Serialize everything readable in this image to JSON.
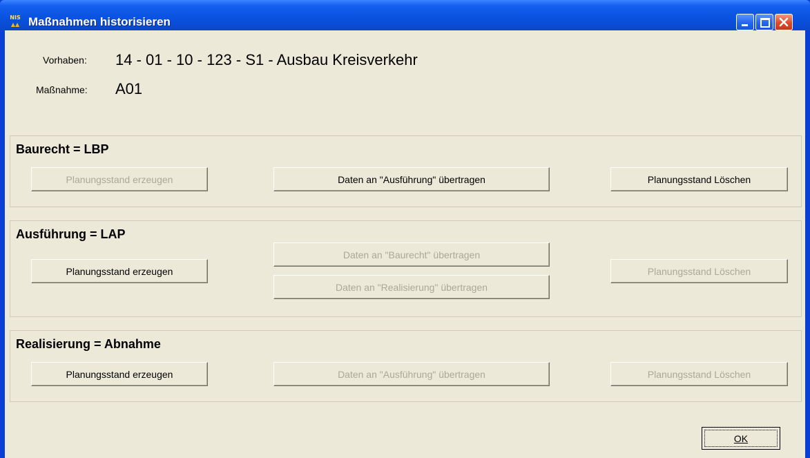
{
  "window": {
    "title": "Maßnahmen historisieren",
    "icon_line1": "NIS",
    "icon_line2": "▲▲"
  },
  "header": {
    "vorhaben_label": "Vorhaben:",
    "vorhaben_value": "14 - 01 - 10 - 123 - S1 - Ausbau Kreisverkehr",
    "massnahme_label": "Maßnahme:",
    "massnahme_value": "A01"
  },
  "groups": [
    {
      "title": "Baurecht = LBP",
      "create_label": "Planungsstand erzeugen",
      "transfer_label": "Daten an \"Ausführung\" übertragen",
      "delete_label": "Planungsstand Löschen"
    },
    {
      "title": "Ausführung = LAP",
      "create_label": "Planungsstand erzeugen",
      "transfer_baurecht_label": "Daten an \"Baurecht\" übertragen",
      "transfer_realisierung_label": "Daten an \"Realisierung\" übertragen",
      "delete_label": "Planungsstand Löschen"
    },
    {
      "title": "Realisierung = Abnahme",
      "create_label": "Planungsstand erzeugen",
      "transfer_label": "Daten an \"Ausführung\" übertragen",
      "delete_label": "Planungsstand Löschen"
    }
  ],
  "footer": {
    "ok_label": "OK"
  }
}
